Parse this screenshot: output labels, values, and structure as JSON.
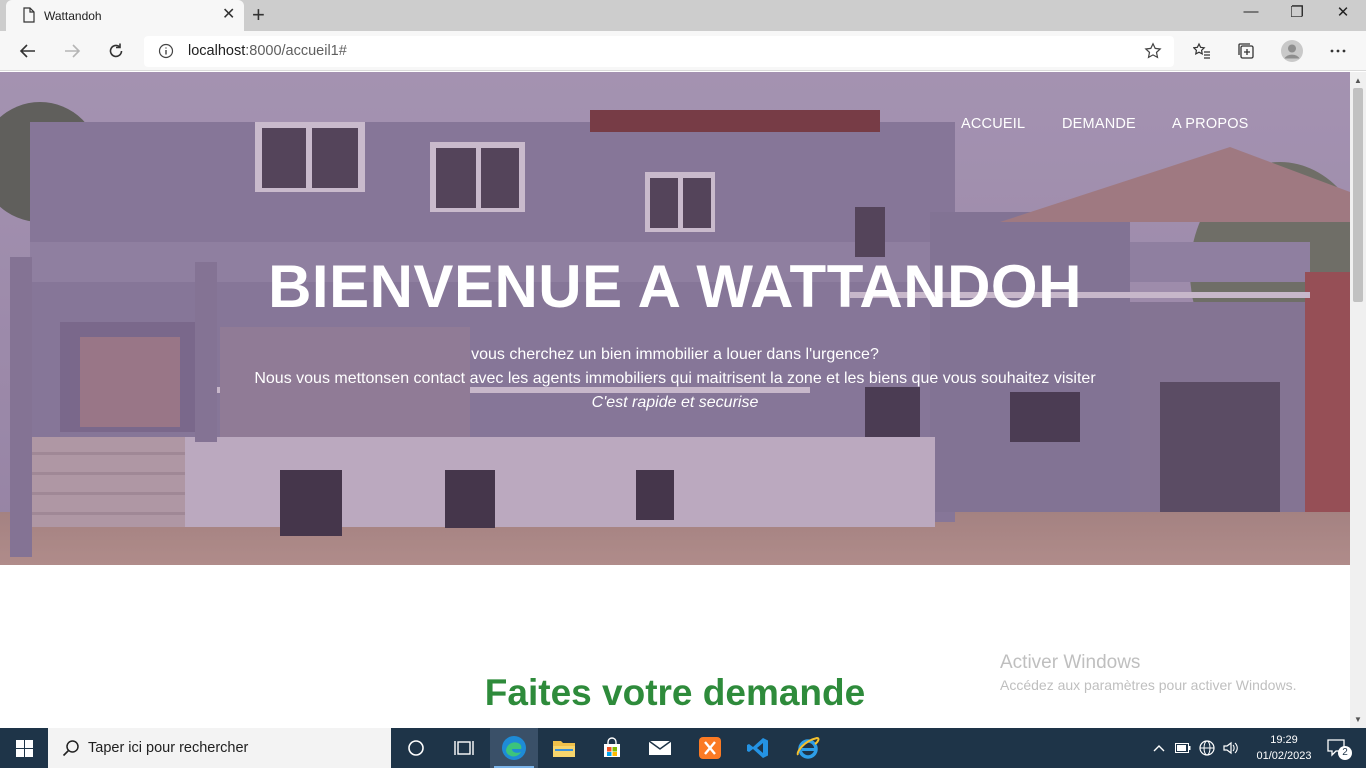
{
  "browser": {
    "tab_title": "Wattandoh",
    "tab_close": "✕",
    "new_tab": "+",
    "url_host": "localhost",
    "url_rest": ":8000/accueil1#",
    "window": {
      "minimize": "—",
      "restore": "❐",
      "close": "✕"
    }
  },
  "site": {
    "nav": [
      "ACCUEIL",
      "DEMANDE",
      "A PROPOS"
    ],
    "hero_title": "BIENVENUE A WATTANDOH",
    "hero_line1": "vous cherchez un bien immobilier a louer dans l'urgence?",
    "hero_line2": "Nous vous mettonsen contact avec les agents immobiliers qui maitrisent la zone et les biens que vous souhaitez visiter",
    "hero_line3": "C'est rapide et securise",
    "section_title": "Faites votre demande"
  },
  "watermark": {
    "title": "Activer Windows",
    "subtitle": "Accédez aux paramètres pour activer Windows."
  },
  "taskbar": {
    "search_placeholder": "Taper ici pour rechercher",
    "time": "19:29",
    "date": "01/02/2023",
    "notification_count": "2"
  },
  "colors": {
    "section_title": "#2e8b3b",
    "taskbar": "#1e3448",
    "tab_bar": "#cdcdcd"
  },
  "icons": [
    "page-icon",
    "back-icon",
    "forward-icon",
    "refresh-icon",
    "info-icon",
    "star-icon",
    "favorites-icon",
    "collections-icon",
    "profile-icon",
    "more-icon",
    "windows-start-icon",
    "search-icon",
    "cortana-icon",
    "task-view-icon",
    "edge-icon",
    "file-explorer-icon",
    "store-icon",
    "mail-icon",
    "xampp-icon",
    "vscode-icon",
    "ie-icon",
    "chevron-up-icon",
    "battery-icon",
    "network-icon",
    "volume-icon",
    "notification-icon"
  ]
}
